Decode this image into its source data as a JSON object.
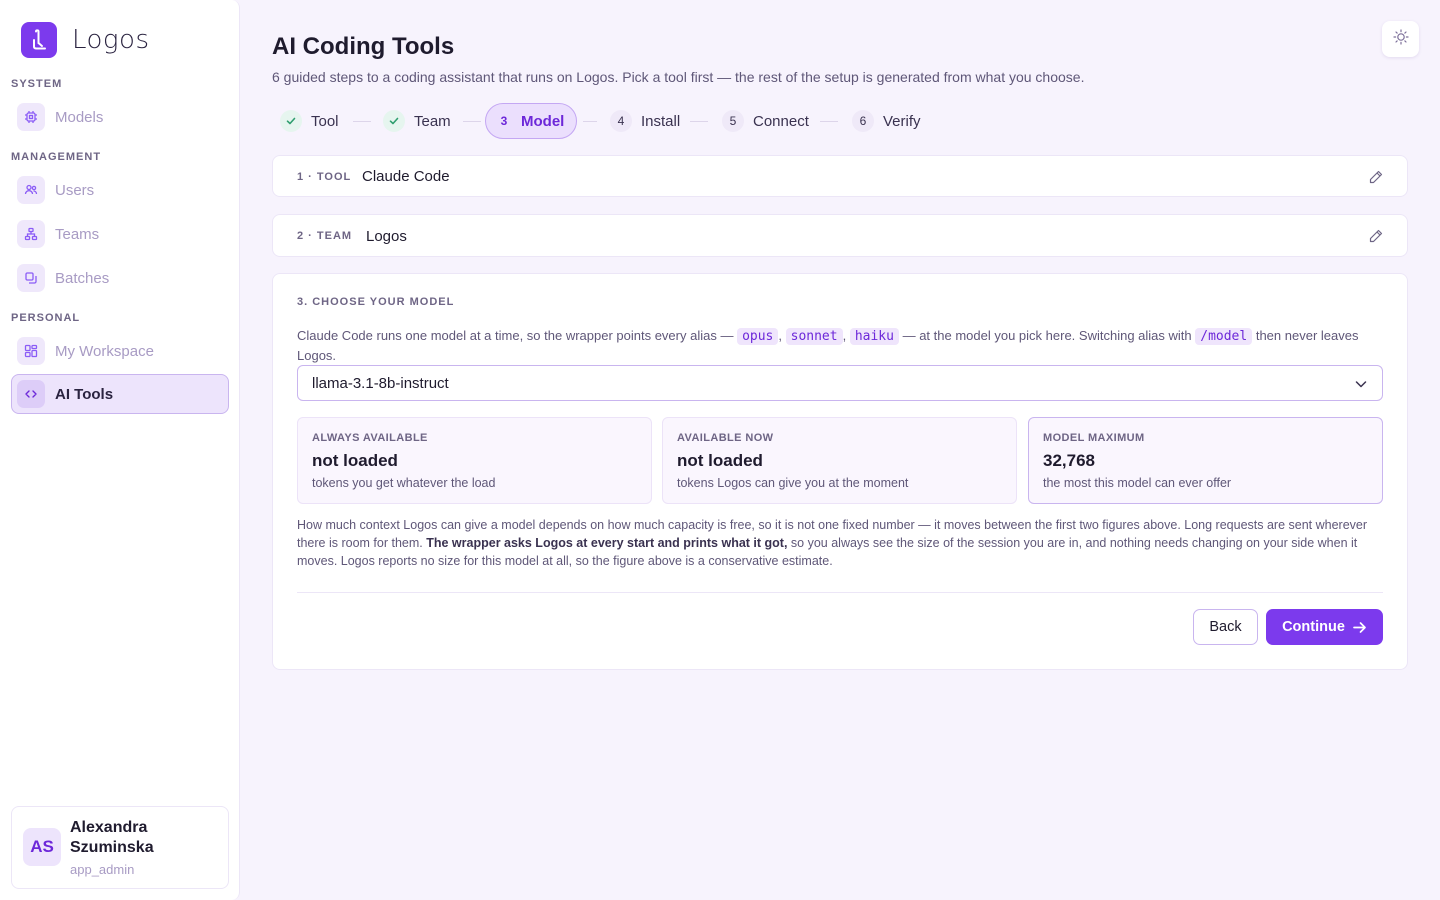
{
  "app": {
    "name": "Logos",
    "accent": "#7c3aed"
  },
  "sidebar": {
    "sections": [
      {
        "label": "SYSTEM",
        "items": [
          {
            "label": "Models",
            "icon": "chip-icon"
          }
        ]
      },
      {
        "label": "MANAGEMENT",
        "items": [
          {
            "label": "Users",
            "icon": "users-icon"
          },
          {
            "label": "Teams",
            "icon": "org-chart-icon"
          },
          {
            "label": "Batches",
            "icon": "copy-icon"
          }
        ]
      },
      {
        "label": "PERSONAL",
        "items": [
          {
            "label": "My Workspace",
            "icon": "grid-icon"
          },
          {
            "label": "AI Tools",
            "icon": "code-icon",
            "active": true
          }
        ]
      }
    ]
  },
  "user": {
    "initials": "AS",
    "name": "Alexandra Szuminska",
    "role": "app_admin"
  },
  "page": {
    "title": "AI Coding Tools",
    "subtitle": "6 guided steps to a coding assistant that runs on Logos. Pick a tool first — the rest of the setup is generated from what you choose."
  },
  "stepper": {
    "steps": [
      {
        "number": "1",
        "label": "Tool",
        "state": "done"
      },
      {
        "number": "2",
        "label": "Team",
        "state": "done"
      },
      {
        "number": "3",
        "label": "Model",
        "state": "active"
      },
      {
        "number": "4",
        "label": "Install",
        "state": "pending"
      },
      {
        "number": "5",
        "label": "Connect",
        "state": "pending"
      },
      {
        "number": "6",
        "label": "Verify",
        "state": "pending"
      }
    ]
  },
  "summary": {
    "tool": {
      "label": "1 · TOOL",
      "value": "Claude Code"
    },
    "team": {
      "label": "2 · TEAM",
      "value": "Logos"
    }
  },
  "model_section": {
    "label": "3. CHOOSE YOUR MODEL",
    "desc_intro": "Claude Code runs one model at a time, so the wrapper points every alias —",
    "aliases": [
      "opus",
      "sonnet",
      "haiku"
    ],
    "desc_mid": "— at the model you pick here. Switching alias with",
    "switch_cmd": "/model",
    "desc_end": "then never leaves Logos.",
    "selected_model": "llama-3.1-8b-instruct",
    "stats": [
      {
        "label": "ALWAYS AVAILABLE",
        "value": "not loaded",
        "caption": "tokens you get whatever the load"
      },
      {
        "label": "AVAILABLE NOW",
        "value": "not loaded",
        "caption": "tokens Logos can give you at the moment"
      },
      {
        "label": "MODEL MAXIMUM",
        "value": "32,768",
        "caption": "the most this model can ever offer"
      }
    ],
    "explain_pre": "How much context Logos can give a model depends on how much capacity is free, so it is not one fixed number — it moves between the first two figures above. Long requests are sent wherever there is room for them.",
    "explain_bold": "The wrapper asks Logos at every start and prints what it got,",
    "explain_post": "so you always see the size of the session you are in, and nothing needs changing on your side when it moves. Logos reports no size for this model at all, so the figure above is a conservative estimate.",
    "back_label": "Back",
    "continue_label": "Continue"
  }
}
